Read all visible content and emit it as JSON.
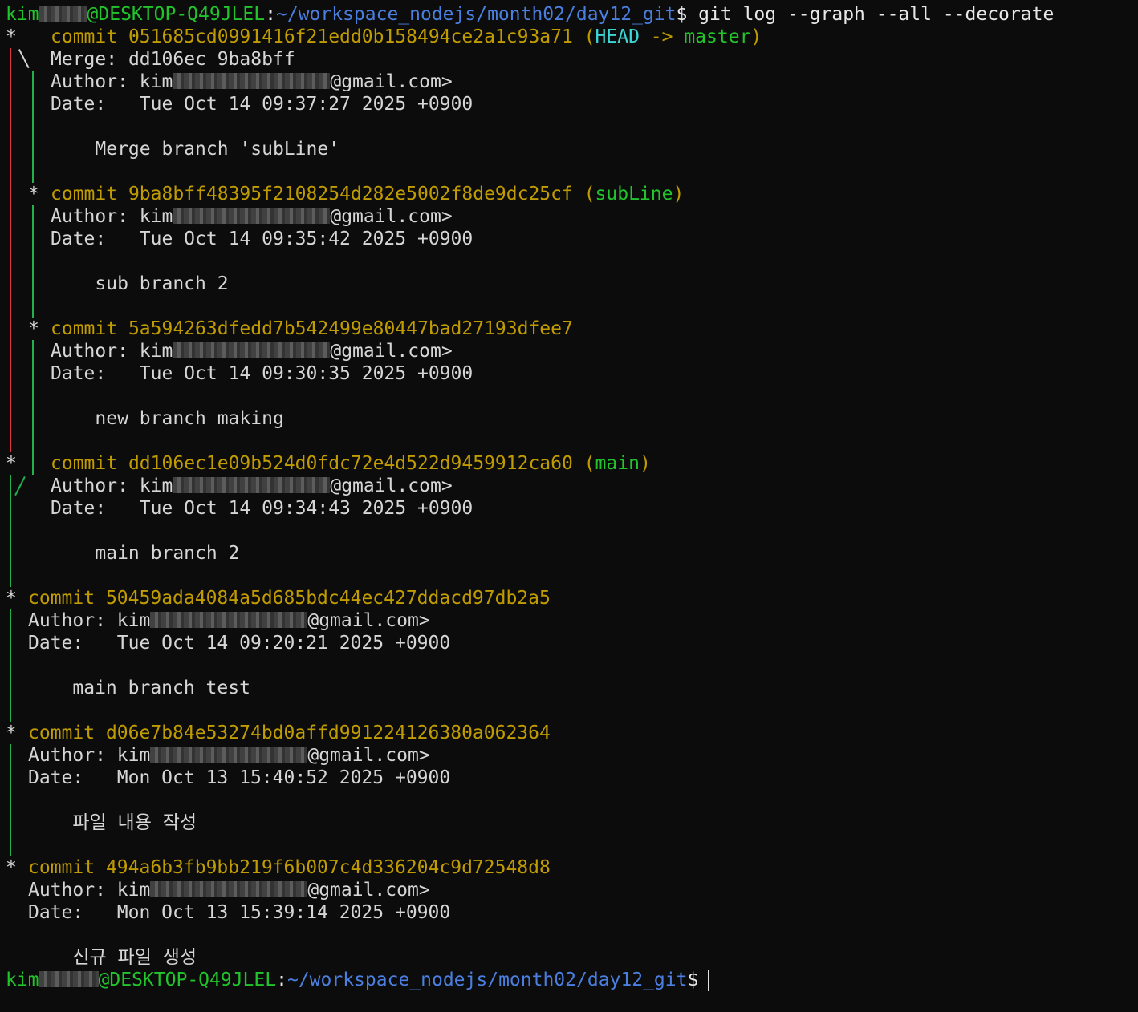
{
  "prompt": {
    "user": "kim",
    "host": "@DESKTOP-Q49JLEL",
    "separator": ":",
    "path": "~/workspace_nodejs/month02/day12_git",
    "symbol": "$",
    "command": " git log --graph --all --decorate"
  },
  "labels": {
    "commit": "commit",
    "merge": "Merge:",
    "author": "Author:",
    "date": "Date:",
    "email_suffix": "@gmail.com>"
  },
  "commits": [
    {
      "hash": "051685cd0991416f21edd0b158494ce2a1c93a71",
      "head": "HEAD",
      "arrow": " -> ",
      "ref": "master",
      "merge": "dd106ec 9ba8bff",
      "author": "kim",
      "date": "Tue Oct 14 09:37:27 2025 +0900",
      "message": "Merge branch 'subLine'"
    },
    {
      "hash": "9ba8bff48395f2108254d282e5002f8de9dc25cf",
      "ref": "subLine",
      "author": "kim",
      "date": "Tue Oct 14 09:35:42 2025 +0900",
      "message": "sub branch 2"
    },
    {
      "hash": "5a594263dfedd7b542499e80447bad27193dfee7",
      "author": "kim",
      "date": "Tue Oct 14 09:30:35 2025 +0900",
      "message": "new branch making"
    },
    {
      "hash": "dd106ec1e09b524d0fdc72e4d522d9459912ca60",
      "ref": "main",
      "author": "kim",
      "date": "Tue Oct 14 09:34:43 2025 +0900",
      "message": "main branch 2"
    },
    {
      "hash": "50459ada4084a5d685bdc44ec427ddacd97db2a5",
      "author": "kim",
      "date": "Tue Oct 14 09:20:21 2025 +0900",
      "message": "main branch test"
    },
    {
      "hash": "d06e7b84e53274bd0affd991224126380a062364",
      "author": "kim",
      "date": "Mon Oct 13 15:40:52 2025 +0900",
      "message": "파일 내용 작성"
    },
    {
      "hash": "494a6b3fb9bb219f6b007c4d336204c9d72548d8",
      "author": "kim",
      "date": "Mon Oct 13 15:39:14 2025 +0900",
      "message": "신규 파일 생성"
    }
  ],
  "colors": {
    "background": "#0c0c0c",
    "hash": "#c19c00",
    "head": "#3dd6d6",
    "branch": "#22c42c",
    "path": "#4a7fe0",
    "graph_red": "#e0343c",
    "graph_green": "#22b14c"
  }
}
